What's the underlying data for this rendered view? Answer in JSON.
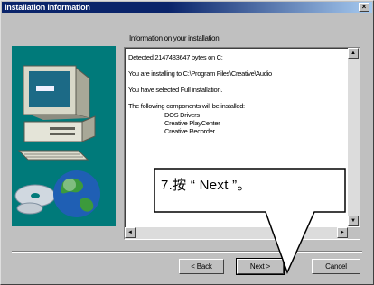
{
  "window": {
    "title": "Installation Information",
    "close_glyph": "×"
  },
  "intro_text": "Information on your installation:",
  "details": {
    "lines": [
      "Detected 2147483647 bytes on C:",
      "You are installing to C:\\Program Files\\Creative\\Audio",
      "You have selected Full installation.",
      "The following components will be installed:"
    ],
    "components": [
      "DOS Drivers",
      "Creative PlayCenter",
      "Creative Recorder"
    ]
  },
  "scrollbar": {
    "up_glyph": "▲",
    "down_glyph": "▼",
    "left_glyph": "◄",
    "right_glyph": "►"
  },
  "buttons": {
    "back": "< Back",
    "next": "Next >",
    "cancel": "Cancel"
  },
  "callout": {
    "text": "7.按 “ Next ”。"
  },
  "art": {
    "icons": [
      "computer-icon",
      "globe-icon",
      "cd-icon"
    ],
    "background_color": "#007a7a"
  }
}
